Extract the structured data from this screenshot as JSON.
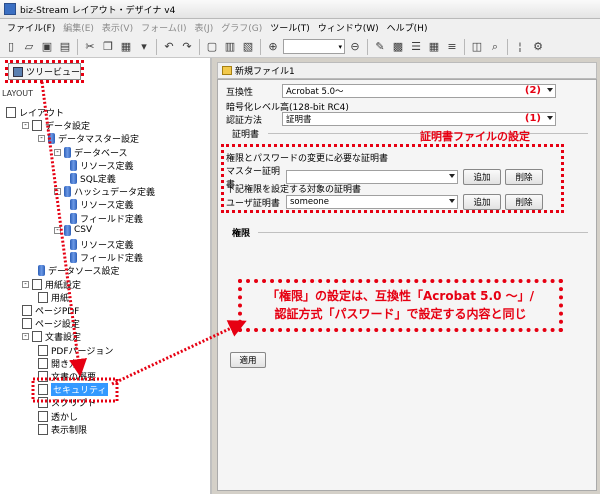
{
  "window": {
    "title": "biz-Stream レイアウト・デザイナ v4"
  },
  "menubar": [
    {
      "label": "ファイル(F)",
      "disabled": false
    },
    {
      "label": "編集(E)",
      "disabled": true
    },
    {
      "label": "表示(V)",
      "disabled": true
    },
    {
      "label": "フォーム(I)",
      "disabled": true
    },
    {
      "label": "表(J)",
      "disabled": true
    },
    {
      "label": "グラフ(G)",
      "disabled": true
    },
    {
      "label": "ツール(T)",
      "disabled": false
    },
    {
      "label": "ウィンドウ(W)",
      "disabled": false
    },
    {
      "label": "ヘルプ(H)",
      "disabled": false
    }
  ],
  "tree_panel": {
    "tab_label": "ツリービュー",
    "header": "LAYOUT",
    "nodes": [
      {
        "label": "レイアウト",
        "level": 0,
        "icon": "layout-icon"
      },
      {
        "label": "データ設定",
        "level": 1,
        "icon": "folder-icon",
        "toggle": "-"
      },
      {
        "label": "データマスター設定",
        "level": 2,
        "icon": "db-icon",
        "toggle": "-"
      },
      {
        "label": "データベース",
        "level": 3,
        "icon": "db-icon",
        "toggle": "-"
      },
      {
        "label": "リソース定義",
        "level": 4,
        "icon": "db-icon"
      },
      {
        "label": "SQL定義",
        "level": 4,
        "icon": "db-icon"
      },
      {
        "label": "ハッシュデータ定義",
        "level": 3,
        "icon": "db-icon",
        "toggle": "-"
      },
      {
        "label": "リソース定義",
        "level": 4,
        "icon": "db-icon"
      },
      {
        "label": "フィールド定義",
        "level": 4,
        "icon": "db-icon"
      },
      {
        "label": "CSV",
        "level": 3,
        "icon": "db-icon",
        "toggle": "-"
      },
      {
        "label": "リソース定義",
        "level": 4,
        "icon": "db-icon"
      },
      {
        "label": "フィールド定義",
        "level": 4,
        "icon": "db-icon"
      },
      {
        "label": "データソース設定",
        "level": 2,
        "icon": "db-icon"
      },
      {
        "label": "用紙設定",
        "level": 1,
        "icon": "page-icon",
        "toggle": "-"
      },
      {
        "label": "用紙",
        "level": 2,
        "icon": "page-icon"
      },
      {
        "label": "ページPDF",
        "level": 1,
        "icon": "page-icon"
      },
      {
        "label": "ページ設定",
        "level": 1,
        "icon": "page-icon"
      },
      {
        "label": "文書設定",
        "level": 1,
        "icon": "page-icon",
        "toggle": "-"
      },
      {
        "label": "PDFバージョン",
        "level": 2,
        "icon": "page-icon"
      },
      {
        "label": "開き方",
        "level": 2,
        "icon": "page-icon"
      },
      {
        "label": "文書の概要",
        "level": 2,
        "icon": "page-icon"
      },
      {
        "label": "セキュリティ",
        "level": 2,
        "icon": "page-icon",
        "selected": true
      },
      {
        "label": "スクリプト",
        "level": 2,
        "icon": "page-icon"
      },
      {
        "label": "透かし",
        "level": 2,
        "icon": "page-icon"
      },
      {
        "label": "表示制限",
        "level": 2,
        "icon": "page-icon"
      }
    ]
  },
  "document": {
    "tab_label": "新規ファイル1",
    "compat_label": "互換性",
    "compat_value": "Acrobat 5.0～",
    "compat_note": "(2)",
    "encryption_text": "暗号化レベル高(128-bit RC4)",
    "auth_label": "認証方法",
    "auth_value": "証明書",
    "auth_note": "(1)",
    "cert_group_label": "証明書",
    "cert_callout": "証明書ファイルの設定",
    "master_heading": "権限とパスワードの変更に必要な証明書",
    "master_label": "マスター証明書",
    "master_value": "",
    "user_heading": "下記権限を設定する対象の証明書",
    "user_label": "ユーザ証明書",
    "user_value": "someone",
    "add_label": "追加",
    "delete_label": "削除",
    "perm_label": "権限",
    "perm_callout_line1": "「権限」の設定は、互換性「Acrobat 5.0 ～」/",
    "perm_callout_line2": "認証方式「パスワード」で設定する内容と同じ",
    "apply_label": "適用"
  }
}
